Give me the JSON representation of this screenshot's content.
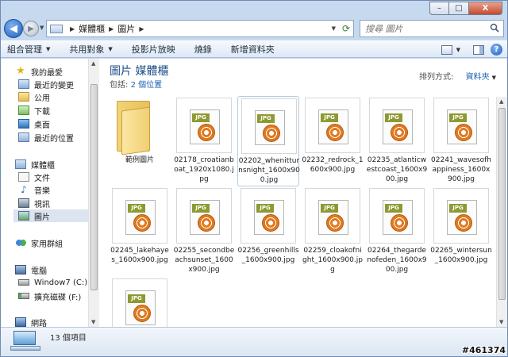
{
  "caption": {
    "minimize": "–",
    "maximize": "□",
    "close": "X"
  },
  "address": {
    "crumbs": [
      "媒體櫃",
      "圖片"
    ],
    "search_placeholder": "搜尋 圖片"
  },
  "toolbar": {
    "organize": "組合管理",
    "share": "共用對象",
    "slideshow": "投影片放映",
    "burn": "燒錄",
    "new_folder": "新增資料夾"
  },
  "nav": {
    "favorites": "我的最愛",
    "recent_changes": "最近的變更",
    "public": "公用",
    "downloads": "下載",
    "desktop": "桌面",
    "recent_places": "最近的位置",
    "libraries": "媒體櫃",
    "documents": "文件",
    "music": "音樂",
    "videos": "視訊",
    "pictures": "圖片",
    "homegroup": "家用群組",
    "computer": "電腦",
    "drive_c": "Window7 (C:)",
    "drive_f": "擴充磁碟 (F:)",
    "network": "網路"
  },
  "library": {
    "title": "圖片 媒體櫃",
    "includes_label": "包括:",
    "locations_link": "2 個位置",
    "arrange_label": "排列方式:",
    "arrange_value": "資料夾"
  },
  "items": [
    {
      "name": "範例圖片",
      "type": "folder"
    },
    {
      "name": "02178_croatianboat_1920x1080.jpg",
      "type": "jpg"
    },
    {
      "name": "02202_whenitturnsnight_1600x900.jpg",
      "type": "jpg",
      "selected": true
    },
    {
      "name": "02232_redrock_1600x900.jpg",
      "type": "jpg"
    },
    {
      "name": "02235_atlanticwestcoast_1600x900.jpg",
      "type": "jpg"
    },
    {
      "name": "02241_wavesofhappiness_1600x900.jpg",
      "type": "jpg"
    },
    {
      "name": "02245_lakehayes_1600x900.jpg",
      "type": "jpg"
    },
    {
      "name": "02255_secondbeachsunset_1600x900.jpg",
      "type": "jpg"
    },
    {
      "name": "02256_greenhills_1600x900.jpg",
      "type": "jpg"
    },
    {
      "name": "02259_cloakofnight_1600x900.jpg",
      "type": "jpg"
    },
    {
      "name": "02264_thegardenofeden_1600x900.jpg",
      "type": "jpg"
    },
    {
      "name": "02265_wintersun_1600x900.jpg",
      "type": "jpg"
    },
    {
      "name": "",
      "type": "jpg"
    }
  ],
  "jpg_tag": "JPG",
  "details": {
    "count": "13 個項目"
  },
  "watermark": "#461374"
}
